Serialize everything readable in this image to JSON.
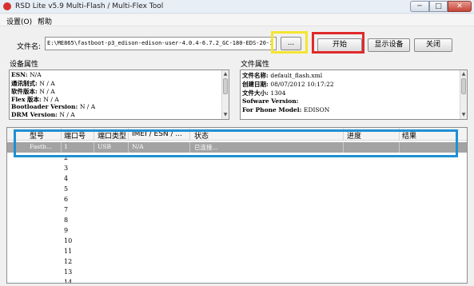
{
  "window": {
    "title": "RSD Lite v5.9 Multi-Flash / Multi-Flex Tool",
    "minimize_glyph": "─",
    "maximize_glyph": "□",
    "close_glyph": "✕"
  },
  "menu": {
    "settings": "设置(O)",
    "help": "帮助"
  },
  "file": {
    "label": "文件名:",
    "path": "E:\\ME865\\fastboot-p3_edison-edison-user-4.0.4-6.7.2_GC-180-EDS-20-1"
  },
  "buttons": {
    "browse": "...",
    "start": "开始",
    "show_devices": "显示设备",
    "close": "关闭"
  },
  "device_properties": {
    "label": "设备属性",
    "rows": [
      {
        "key": "ESN: ",
        "value": "N/A"
      },
      {
        "key": "通讯制式: ",
        "value": "N / A"
      },
      {
        "key": "软件版本: ",
        "value": "N / A"
      },
      {
        "key": "Flex 版本: ",
        "value": "N / A"
      },
      {
        "key": "Bootloader Version: ",
        "value": "N / A"
      },
      {
        "key": "DRM Version: ",
        "value": "N / A"
      }
    ]
  },
  "file_properties": {
    "label": "文件属性",
    "rows": [
      {
        "key": "文件名称: ",
        "value": "default_flash.xml"
      },
      {
        "key": "创建日期: ",
        "value": "08/07/2012 10:17:22"
      },
      {
        "key": "文件大小: ",
        "value": "1304"
      },
      {
        "key": "Sofware Version: ",
        "value": ""
      },
      {
        "key": "For Phone Model: ",
        "value": "EDISON"
      }
    ]
  },
  "grid": {
    "headers": [
      "型号",
      "端口号",
      "端口类型",
      "IMEI / ESN / ...",
      "状态",
      "进度",
      "结果"
    ],
    "selected_row": {
      "model": "Fastb...",
      "port": "1",
      "port_type": "USB",
      "imei": "N/A",
      "status": "已连接..."
    },
    "port_numbers": [
      "2",
      "3",
      "4",
      "5",
      "6",
      "7",
      "8",
      "9",
      "10",
      "11",
      "12",
      "13",
      "14"
    ]
  },
  "colors": {
    "highlight_yellow": "#f4e531",
    "highlight_red": "#e02a2a",
    "highlight_blue": "#1f8fd3",
    "selected_row": "#a3a3a3",
    "title_icon": "#d6312f"
  },
  "icons": [
    "motorola-logo-icon",
    "minimize-icon",
    "maximize-icon",
    "close-icon",
    "scroll-up-icon",
    "scroll-down-icon"
  ]
}
